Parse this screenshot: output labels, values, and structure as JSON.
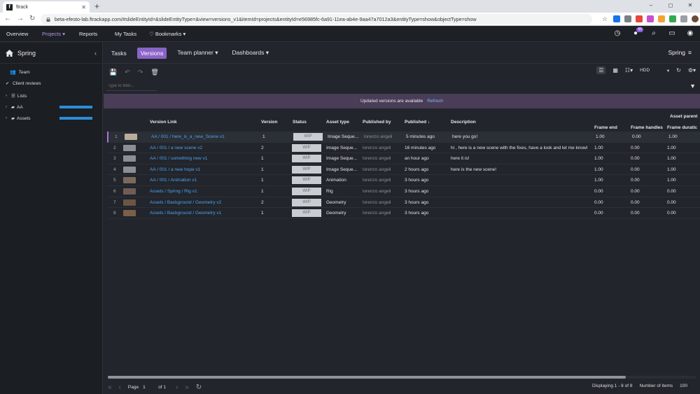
{
  "browser": {
    "tab_title": "ftrack",
    "favicon_letter": "f",
    "url": "beta-efesto-lab.ftrackapp.com/#slideEntityId=&slideEntityType=&view=versions_v1&itemId=projects&entityId=e56985fc-6a91-11ea-ab4e-9aa47a7012a3&entityType=show&objectType=show",
    "window_controls": [
      "–",
      "◻",
      "✕"
    ]
  },
  "topnav": {
    "overview": "Overview",
    "projects": "Projects",
    "reports": "Reports",
    "my_tasks": "My Tasks",
    "bookmarks": "Bookmarks",
    "notification_count": "65"
  },
  "sidebar": {
    "title": "Spring",
    "items": [
      {
        "label": "Team"
      },
      {
        "label": "Client reviews"
      },
      {
        "label": "Lists"
      },
      {
        "label": "AA"
      },
      {
        "label": "Assets"
      }
    ]
  },
  "tabs": {
    "tasks": "Tasks",
    "versions": "Versions",
    "team_planner": "Team planner",
    "dashboards": "Dashboards",
    "project": "Spring"
  },
  "toolbar": {
    "resolution": "HDD",
    "filter_placeholder": "Type to filter..."
  },
  "banner": {
    "text": "Updated versions are available",
    "refresh": "Refresh"
  },
  "table": {
    "group_header": "Asset parent",
    "headers": {
      "version_link": "Version Link",
      "version": "Version",
      "status": "Status",
      "asset_type": "Asset type",
      "published_by": "Published by",
      "published": "Published ↓",
      "description": "Description",
      "frame_end": "Frame end",
      "frame_handles": "Frame handles",
      "frame_duration": "Frame duratic"
    },
    "rows": [
      {
        "idx": "1",
        "link": "AA / 001 / here_is_a_new_Scene v1",
        "version": "1",
        "status": "WIP",
        "asset_type": "Image Seque...",
        "published_by": "lorenzo angeli",
        "published": "5 minutes ago",
        "description": "here you go!",
        "frame_end": "1.00",
        "frame_handles": "0.00",
        "frame_duration": "1.00"
      },
      {
        "idx": "2",
        "link": "AA / 001 / a new scene v2",
        "version": "2",
        "status": "WIP",
        "asset_type": "Image Seque...",
        "published_by": "lorenzo angeli",
        "published": "16 minutes ago",
        "description": "hi , here is a new scene with the fixes, have a look and let me knowl",
        "frame_end": "1.00",
        "frame_handles": "0.00",
        "frame_duration": "1.00"
      },
      {
        "idx": "3",
        "link": "AA / 001 / something new v1",
        "version": "1",
        "status": "WIP",
        "asset_type": "Image Seque...",
        "published_by": "lorenzo angeli",
        "published": "an hour ago",
        "description": "here it is!",
        "frame_end": "1.00",
        "frame_handles": "0.00",
        "frame_duration": "1.00"
      },
      {
        "idx": "4",
        "link": "AA / 001 / a new hope v1",
        "version": "1",
        "status": "WIP",
        "asset_type": "Image Seque...",
        "published_by": "lorenzo angeli",
        "published": "2 hours ago",
        "description": "here is the new scene!",
        "frame_end": "1.00",
        "frame_handles": "0.00",
        "frame_duration": "1.00"
      },
      {
        "idx": "5",
        "link": "AA / 001 / Animation v1",
        "version": "1",
        "status": "WIP",
        "asset_type": "Animation",
        "published_by": "lorenzo angeli",
        "published": "3 hours ago",
        "description": "",
        "frame_end": "1.00",
        "frame_handles": "0.00",
        "frame_duration": "1.00"
      },
      {
        "idx": "6",
        "link": "Assets / Spring / Rig v1",
        "version": "1",
        "status": "WIP",
        "asset_type": "Rig",
        "published_by": "lorenzo angeli",
        "published": "3 hours ago",
        "description": "",
        "frame_end": "0.00",
        "frame_handles": "0.00",
        "frame_duration": "0.00"
      },
      {
        "idx": "7",
        "link": "Assets / Background / Geometry v2",
        "version": "2",
        "status": "WIP",
        "asset_type": "Geometry",
        "published_by": "lorenzo angeli",
        "published": "3 hours ago",
        "description": "",
        "frame_end": "0.00",
        "frame_handles": "0.00",
        "frame_duration": "0.00"
      },
      {
        "idx": "8",
        "link": "Assets / Background / Geometry v1",
        "version": "1",
        "status": "WIP",
        "asset_type": "Geometry",
        "published_by": "lorenzo angeli",
        "published": "3 hours ago",
        "description": "",
        "frame_end": "0.00",
        "frame_handles": "0.00",
        "frame_duration": "0.00"
      }
    ]
  },
  "footer": {
    "page_label": "Page",
    "page": "1",
    "of": "of 1",
    "displaying": "Displaying 1 - 8 of 8",
    "items_label": "Number of items",
    "items": "100"
  },
  "colors": {
    "accent": "#8a63c9",
    "link": "#4da3f0",
    "banner": "#4a3d57",
    "progress": "#2a8ddb"
  }
}
